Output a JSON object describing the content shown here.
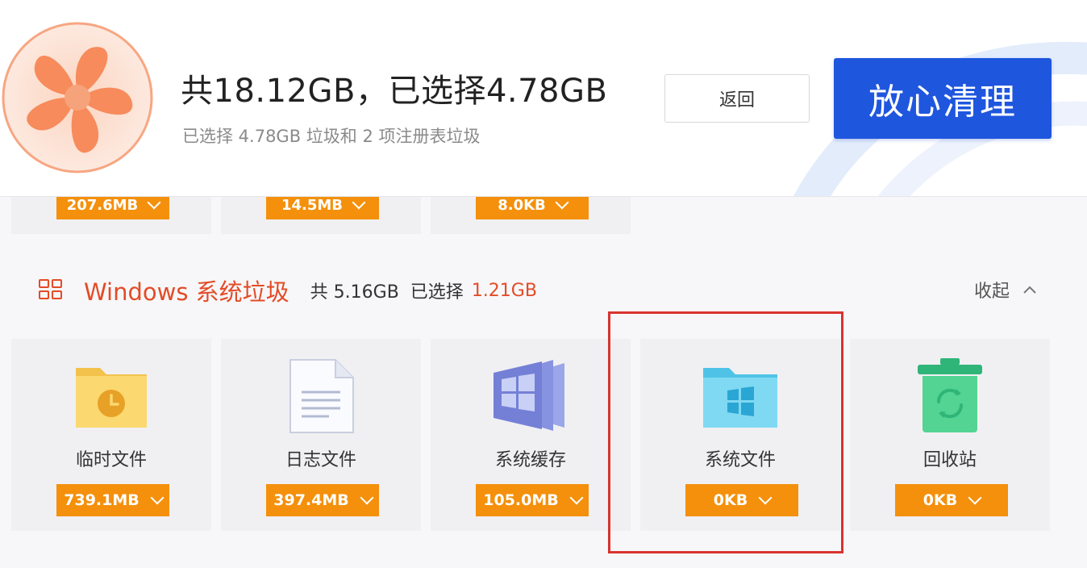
{
  "header": {
    "title": "共18.12GB，已选择4.78GB",
    "subtitle": "已选择 4.78GB 垃圾和 2 项注册表垃圾",
    "back_label": "返回",
    "clean_label": "放心清理",
    "fan_icon": "fan-icon"
  },
  "previous_row": {
    "badges": [
      "207.6MB",
      "14.5MB",
      "8.0KB"
    ]
  },
  "section": {
    "title": "Windows 系统垃圾",
    "total": "共 5.16GB",
    "selected_label": "已选择",
    "selected_value": "1.21GB",
    "collapse_label": "收起",
    "icon": "grid-icon"
  },
  "cards": [
    {
      "label": "临时文件",
      "size": "739.1MB",
      "icon": "temp-folder-icon"
    },
    {
      "label": "日志文件",
      "size": "397.4MB",
      "icon": "log-document-icon"
    },
    {
      "label": "系统缓存",
      "size": "105.0MB",
      "icon": "windows-cache-icon"
    },
    {
      "label": "系统文件",
      "size": "0KB",
      "icon": "windows-folder-icon"
    },
    {
      "label": "回收站",
      "size": "0KB",
      "icon": "recycle-bin-icon"
    }
  ],
  "colors": {
    "accent_orange": "#f4900c",
    "section_red": "#e44b26",
    "primary_blue": "#1f56de",
    "highlight_red": "#d9332f"
  }
}
